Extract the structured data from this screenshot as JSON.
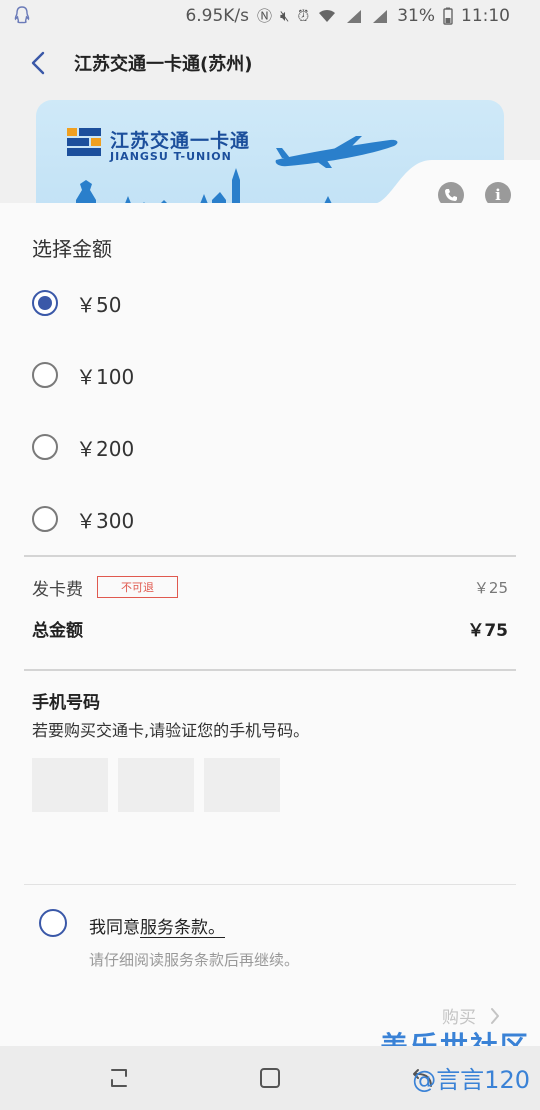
{
  "status_bar": {
    "speed": "6.95K/s",
    "battery": "31%",
    "time": "11:10"
  },
  "header": {
    "title": "江苏交通一卡通(苏州)"
  },
  "card": {
    "name_cn": "江苏交通一卡通",
    "name_en": "JIANGSU T-UNION",
    "brand_color": "#1c4f9c"
  },
  "amount": {
    "section_title": "选择金额",
    "options": [
      {
        "label": "￥50",
        "selected": true
      },
      {
        "label": "￥100",
        "selected": false
      },
      {
        "label": "￥200",
        "selected": false
      },
      {
        "label": "￥300",
        "selected": false
      }
    ]
  },
  "fees": {
    "card_fee_label": "发卡费",
    "card_fee_badge": "不可退",
    "card_fee_value": "￥25",
    "total_label": "总金额",
    "total_value": "￥75"
  },
  "phone": {
    "title": "手机号码",
    "description": "若要购买交通卡,请验证您的手机号码。"
  },
  "terms": {
    "agree_prefix": "我同意",
    "agree_link": "服务条款。",
    "hint": "请仔细阅读服务条款后再继续。"
  },
  "actions": {
    "buy_label": "购买"
  },
  "watermark": {
    "line1": "盖乐世社区",
    "line2": "@言言120"
  },
  "colors": {
    "accent": "#3a58a8",
    "badge_red": "#e0594f",
    "watermark_blue": "#3a82d6"
  }
}
